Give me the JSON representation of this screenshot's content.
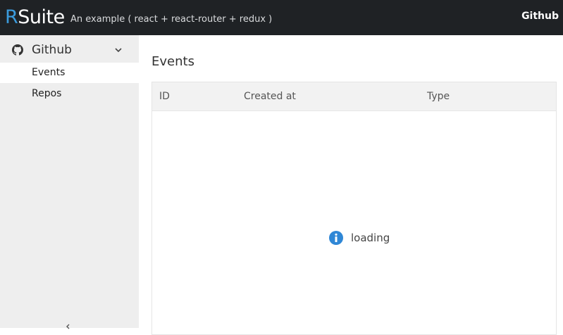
{
  "header": {
    "logo_first": "R",
    "logo_rest": "Suite",
    "subtitle": "An example ( react + react-router + redux )",
    "nav_right": "Github"
  },
  "sidebar": {
    "group": {
      "label": "Github",
      "icon": "github-icon"
    },
    "items": [
      {
        "label": "Events",
        "active": true
      },
      {
        "label": "Repos",
        "active": false
      }
    ]
  },
  "main": {
    "title": "Events",
    "table": {
      "columns": [
        "ID",
        "Created at",
        "Type"
      ],
      "status": "loading"
    }
  },
  "colors": {
    "topbar": "#1f2225",
    "accent": "#3b9bdc",
    "info": "#2f87d6",
    "sidebar": "#eeeeee"
  }
}
